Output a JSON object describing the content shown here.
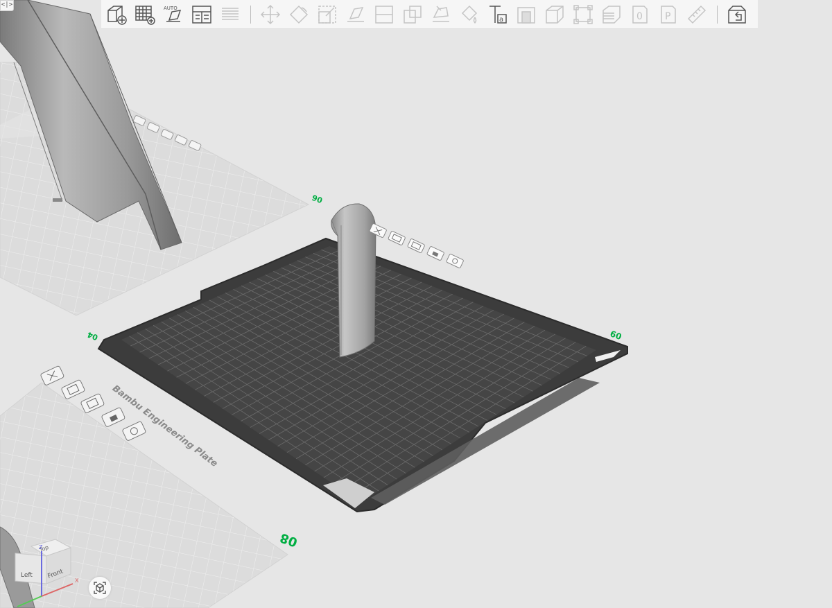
{
  "toolbar": {
    "buttons": [
      {
        "name": "add-object-button",
        "icon": "cube-plus-icon",
        "enabled": true
      },
      {
        "name": "add-plate-button",
        "icon": "grid-plus-icon",
        "enabled": true
      },
      {
        "name": "auto-orient-button",
        "icon": "auto-orient-icon",
        "label": "AUTO",
        "enabled": true
      },
      {
        "name": "arrange-button",
        "icon": "arrange-icon",
        "enabled": true
      },
      {
        "name": "layers-button",
        "icon": "layers-icon",
        "enabled": false
      },
      {
        "name": "move-button",
        "icon": "move-icon",
        "enabled": false
      },
      {
        "name": "rotate-button",
        "icon": "rotate-icon",
        "enabled": false
      },
      {
        "name": "scale-button",
        "icon": "scale-icon",
        "enabled": false
      },
      {
        "name": "lay-on-face-button",
        "icon": "lay-on-face-icon",
        "enabled": false
      },
      {
        "name": "cut-button",
        "icon": "cut-icon",
        "enabled": false
      },
      {
        "name": "boolean-button",
        "icon": "boolean-icon",
        "enabled": false
      },
      {
        "name": "support-paint-button",
        "icon": "support-paint-icon",
        "enabled": false
      },
      {
        "name": "color-paint-button",
        "icon": "paint-bucket-icon",
        "enabled": false
      },
      {
        "name": "text-button",
        "icon": "text-icon",
        "label": "Ta",
        "enabled": true
      },
      {
        "name": "emboss-button",
        "icon": "emboss-icon",
        "enabled": false
      },
      {
        "name": "assembly-button",
        "icon": "box-icon",
        "enabled": false
      },
      {
        "name": "measure-box-button",
        "icon": "bounding-box-icon",
        "enabled": false
      },
      {
        "name": "variable-layer-button",
        "icon": "variable-layer-icon",
        "enabled": false
      },
      {
        "name": "zero-button",
        "icon": "zero-icon",
        "label": "0",
        "enabled": false
      },
      {
        "name": "p-button",
        "icon": "p-icon",
        "label": "P",
        "enabled": false
      },
      {
        "name": "measure-button",
        "icon": "ruler-icon",
        "enabled": false
      },
      {
        "name": "view-button",
        "icon": "box-view-icon",
        "enabled": true
      }
    ]
  },
  "collapse_label": "<|>",
  "plates": [
    {
      "name": "plate-top-left",
      "number": "06"
    },
    {
      "name": "plate-active",
      "number": "09"
    },
    {
      "name": "plate-left",
      "number": "04"
    },
    {
      "name": "plate-bottom-left",
      "number": "08"
    }
  ],
  "engraving_text": "Bambu Engineering Plate",
  "view_cube": {
    "top": "Top",
    "left": "Left",
    "front": "Front",
    "axis_x": "X",
    "axis_z": "Z"
  },
  "colors": {
    "accent": "#00ae42",
    "bed_dark": "#3c3c3c",
    "bed_light": "#d9d9d9",
    "model_gray": "#9e9e9e",
    "background": "#e6e6e6"
  }
}
